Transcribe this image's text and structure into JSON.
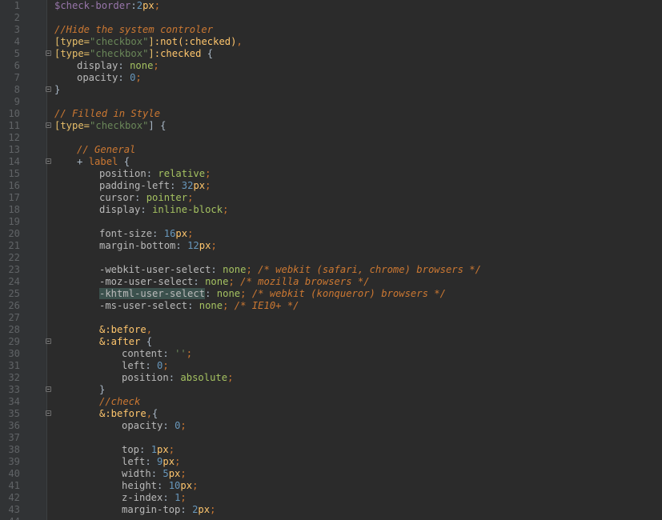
{
  "editor": {
    "language": "scss",
    "colors": {
      "background": "#2b2b2b",
      "gutter": "#313335",
      "line_number": "#606366",
      "comment": "#cc7832",
      "string": "#6a8759",
      "number": "#6897bb"
    }
  },
  "lines": [
    {
      "n": "1",
      "fold": false,
      "indent": 0,
      "tokens": [
        [
          "$check-border",
          "var"
        ],
        [
          ":",
          "p"
        ],
        [
          "2",
          "num"
        ],
        [
          "px",
          "unit"
        ],
        [
          ";",
          "kw"
        ]
      ]
    },
    {
      "n": "2",
      "fold": false,
      "indent": 0,
      "tokens": []
    },
    {
      "n": "3",
      "fold": false,
      "indent": 0,
      "tokens": [
        [
          "//Hide the system controler",
          "comment"
        ]
      ]
    },
    {
      "n": "4",
      "fold": false,
      "indent": 0,
      "tokens": [
        [
          "[type=",
          "bracket"
        ],
        [
          "\"checkbox\"",
          "str"
        ],
        [
          "]",
          "bracket"
        ],
        [
          ":not(:checked)",
          "val"
        ],
        [
          ",",
          "kw"
        ]
      ]
    },
    {
      "n": "5",
      "fold": true,
      "indent": 0,
      "tokens": [
        [
          "[type=",
          "bracket"
        ],
        [
          "\"checkbox\"",
          "str"
        ],
        [
          "]",
          "bracket"
        ],
        [
          ":checked",
          "val"
        ],
        [
          " {",
          "p"
        ]
      ]
    },
    {
      "n": "6",
      "fold": false,
      "indent": 1,
      "tokens": [
        [
          "display",
          "prop"
        ],
        [
          ": ",
          "p"
        ],
        [
          "none",
          "valgreen"
        ],
        [
          ";",
          "kw"
        ]
      ]
    },
    {
      "n": "7",
      "fold": false,
      "indent": 1,
      "tokens": [
        [
          "opacity",
          "prop"
        ],
        [
          ": ",
          "p"
        ],
        [
          "0",
          "num"
        ],
        [
          ";",
          "kw"
        ]
      ]
    },
    {
      "n": "8",
      "fold": true,
      "indent": 0,
      "tokens": [
        [
          "}",
          "p"
        ]
      ]
    },
    {
      "n": "9",
      "fold": false,
      "indent": 0,
      "tokens": []
    },
    {
      "n": "10",
      "fold": false,
      "indent": 0,
      "tokens": [
        [
          "// Filled in Style",
          "comment"
        ]
      ]
    },
    {
      "n": "11",
      "fold": true,
      "indent": 0,
      "tokens": [
        [
          "[type=",
          "bracket"
        ],
        [
          "\"checkbox\"",
          "str"
        ],
        [
          "] {",
          "p"
        ]
      ]
    },
    {
      "n": "12",
      "fold": false,
      "indent": 0,
      "tokens": []
    },
    {
      "n": "13",
      "fold": false,
      "indent": 1,
      "tokens": [
        [
          "// General",
          "comment"
        ]
      ]
    },
    {
      "n": "14",
      "fold": true,
      "indent": 1,
      "tokens": [
        [
          "+ ",
          "p"
        ],
        [
          "label",
          "kw"
        ],
        [
          " {",
          "p"
        ]
      ]
    },
    {
      "n": "15",
      "fold": false,
      "indent": 2,
      "tokens": [
        [
          "position",
          "prop"
        ],
        [
          ": ",
          "p"
        ],
        [
          "relative",
          "valgreen"
        ],
        [
          ";",
          "kw"
        ]
      ]
    },
    {
      "n": "16",
      "fold": false,
      "indent": 2,
      "tokens": [
        [
          "padding-left",
          "prop"
        ],
        [
          ": ",
          "p"
        ],
        [
          "32",
          "num"
        ],
        [
          "px",
          "unit"
        ],
        [
          ";",
          "kw"
        ]
      ]
    },
    {
      "n": "17",
      "fold": false,
      "indent": 2,
      "tokens": [
        [
          "cursor",
          "prop"
        ],
        [
          ": ",
          "p"
        ],
        [
          "pointer",
          "valgreen"
        ],
        [
          ";",
          "kw"
        ]
      ]
    },
    {
      "n": "18",
      "fold": false,
      "indent": 2,
      "tokens": [
        [
          "display",
          "prop"
        ],
        [
          ": ",
          "p"
        ],
        [
          "inline-block",
          "valgreen"
        ],
        [
          ";",
          "kw"
        ]
      ]
    },
    {
      "n": "19",
      "fold": false,
      "indent": 0,
      "tokens": []
    },
    {
      "n": "20",
      "fold": false,
      "indent": 2,
      "tokens": [
        [
          "font-size",
          "prop"
        ],
        [
          ": ",
          "p"
        ],
        [
          "16",
          "num"
        ],
        [
          "px",
          "unit"
        ],
        [
          ";",
          "kw"
        ]
      ]
    },
    {
      "n": "21",
      "fold": false,
      "indent": 2,
      "tokens": [
        [
          "margin-bottom",
          "prop"
        ],
        [
          ": ",
          "p"
        ],
        [
          "12",
          "num"
        ],
        [
          "px",
          "unit"
        ],
        [
          ";",
          "kw"
        ]
      ]
    },
    {
      "n": "22",
      "fold": false,
      "indent": 0,
      "tokens": []
    },
    {
      "n": "23",
      "fold": false,
      "indent": 2,
      "tokens": [
        [
          "-webkit-user-select",
          "prop"
        ],
        [
          ": ",
          "p"
        ],
        [
          "none",
          "valgreen"
        ],
        [
          "; ",
          "kw"
        ],
        [
          "/* webkit (safari, chrome) browsers */",
          "comment"
        ]
      ]
    },
    {
      "n": "24",
      "fold": false,
      "indent": 2,
      "tokens": [
        [
          "-moz-user-select",
          "prop"
        ],
        [
          ": ",
          "p"
        ],
        [
          "none",
          "valgreen"
        ],
        [
          "; ",
          "kw"
        ],
        [
          "/* mozilla browsers */",
          "comment"
        ]
      ]
    },
    {
      "n": "25",
      "fold": false,
      "indent": 2,
      "tokens": [
        [
          "-khtml-user-select",
          "hl"
        ],
        [
          ": ",
          "p"
        ],
        [
          "none",
          "valgreen"
        ],
        [
          "; ",
          "kw"
        ],
        [
          "/* webkit (konqueror) browsers */",
          "comment"
        ]
      ]
    },
    {
      "n": "26",
      "fold": false,
      "indent": 2,
      "tokens": [
        [
          "-ms-user-select",
          "prop"
        ],
        [
          ": ",
          "p"
        ],
        [
          "none",
          "valgreen"
        ],
        [
          "; ",
          "kw"
        ],
        [
          "/* IE10+ */",
          "comment"
        ]
      ]
    },
    {
      "n": "27",
      "fold": false,
      "indent": 0,
      "tokens": []
    },
    {
      "n": "28",
      "fold": false,
      "indent": 2,
      "tokens": [
        [
          "&:before",
          "val"
        ],
        [
          ",",
          "kw"
        ]
      ]
    },
    {
      "n": "29",
      "fold": true,
      "indent": 2,
      "tokens": [
        [
          "&:after",
          "val"
        ],
        [
          " {",
          "p"
        ]
      ]
    },
    {
      "n": "30",
      "fold": false,
      "indent": 3,
      "tokens": [
        [
          "content",
          "prop"
        ],
        [
          ": ",
          "p"
        ],
        [
          "''",
          "str"
        ],
        [
          ";",
          "kw"
        ]
      ]
    },
    {
      "n": "31",
      "fold": false,
      "indent": 3,
      "tokens": [
        [
          "left",
          "prop"
        ],
        [
          ": ",
          "p"
        ],
        [
          "0",
          "num"
        ],
        [
          ";",
          "kw"
        ]
      ]
    },
    {
      "n": "32",
      "fold": false,
      "indent": 3,
      "tokens": [
        [
          "position",
          "prop"
        ],
        [
          ": ",
          "p"
        ],
        [
          "absolute",
          "valgreen"
        ],
        [
          ";",
          "kw"
        ]
      ]
    },
    {
      "n": "33",
      "fold": true,
      "indent": 2,
      "tokens": [
        [
          "}",
          "p"
        ]
      ]
    },
    {
      "n": "34",
      "fold": false,
      "indent": 2,
      "tokens": [
        [
          "//check",
          "comment"
        ]
      ]
    },
    {
      "n": "35",
      "fold": true,
      "indent": 2,
      "tokens": [
        [
          "&:before",
          "val"
        ],
        [
          ",",
          "kw"
        ],
        [
          "{",
          "p"
        ]
      ]
    },
    {
      "n": "36",
      "fold": false,
      "indent": 3,
      "tokens": [
        [
          "opacity",
          "prop"
        ],
        [
          ": ",
          "p"
        ],
        [
          "0",
          "num"
        ],
        [
          ";",
          "kw"
        ]
      ]
    },
    {
      "n": "37",
      "fold": false,
      "indent": 0,
      "tokens": []
    },
    {
      "n": "38",
      "fold": false,
      "indent": 3,
      "tokens": [
        [
          "top",
          "prop"
        ],
        [
          ": ",
          "p"
        ],
        [
          "1",
          "num"
        ],
        [
          "px",
          "unit"
        ],
        [
          ";",
          "kw"
        ]
      ]
    },
    {
      "n": "39",
      "fold": false,
      "indent": 3,
      "tokens": [
        [
          "left",
          "prop"
        ],
        [
          ": ",
          "p"
        ],
        [
          "9",
          "num"
        ],
        [
          "px",
          "unit"
        ],
        [
          ";",
          "kw"
        ]
      ]
    },
    {
      "n": "40",
      "fold": false,
      "indent": 3,
      "tokens": [
        [
          "width",
          "prop"
        ],
        [
          ": ",
          "p"
        ],
        [
          "5",
          "num"
        ],
        [
          "px",
          "unit"
        ],
        [
          ";",
          "kw"
        ]
      ]
    },
    {
      "n": "41",
      "fold": false,
      "indent": 3,
      "tokens": [
        [
          "height",
          "prop"
        ],
        [
          ": ",
          "p"
        ],
        [
          "10",
          "num"
        ],
        [
          "px",
          "unit"
        ],
        [
          ";",
          "kw"
        ]
      ]
    },
    {
      "n": "42",
      "fold": false,
      "indent": 3,
      "tokens": [
        [
          "z-index",
          "prop"
        ],
        [
          ": ",
          "p"
        ],
        [
          "1",
          "num"
        ],
        [
          ";",
          "kw"
        ]
      ]
    },
    {
      "n": "43",
      "fold": false,
      "indent": 3,
      "tokens": [
        [
          "margin-top",
          "prop"
        ],
        [
          ": ",
          "p"
        ],
        [
          "2",
          "num"
        ],
        [
          "px",
          "unit"
        ],
        [
          ";",
          "kw"
        ]
      ]
    },
    {
      "n": "44",
      "fold": false,
      "indent": 0,
      "tokens": []
    }
  ]
}
